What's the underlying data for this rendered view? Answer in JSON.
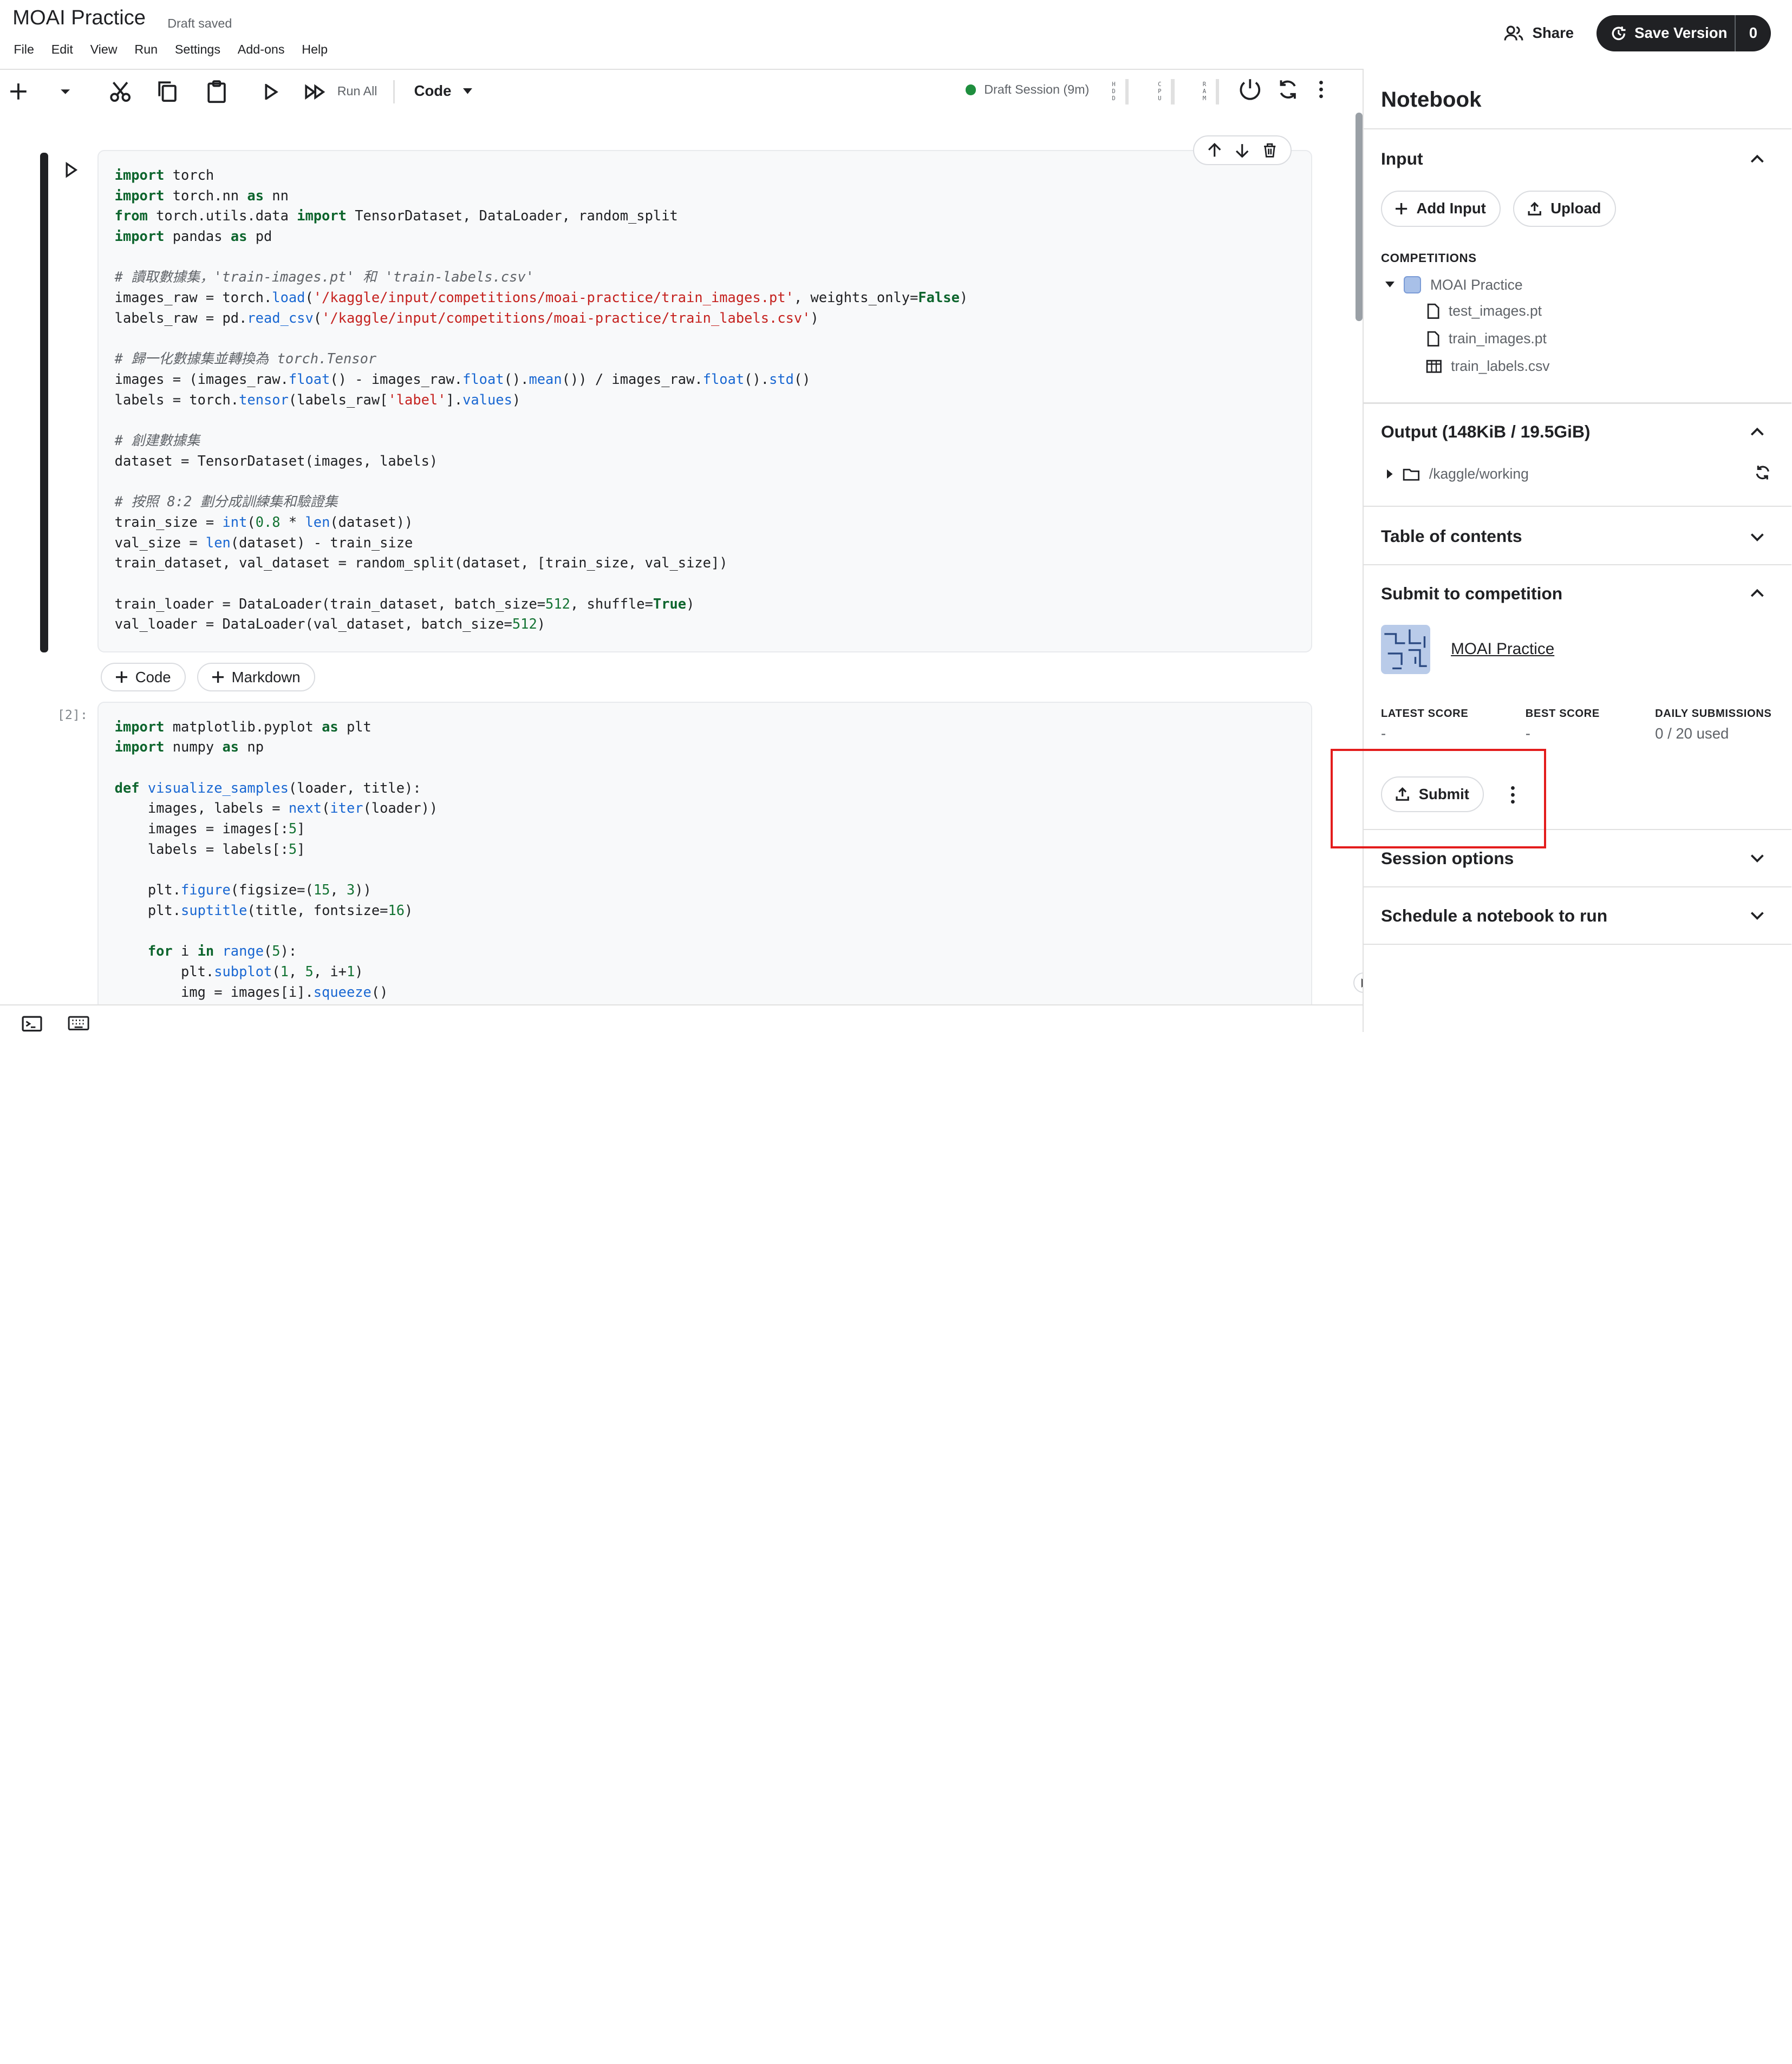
{
  "header": {
    "title": "MOAI Practice",
    "status": "Draft saved",
    "share_label": "Share",
    "save_version_label": "Save Version",
    "save_version_count": "0"
  },
  "menu": [
    "File",
    "Edit",
    "View",
    "Run",
    "Settings",
    "Add-ons",
    "Help"
  ],
  "toolbar": {
    "run_all_label": "Run All",
    "cell_type": "Code",
    "session_label": "Draft Session (9m)",
    "meters": [
      {
        "label": "HDD",
        "icon": "hdd-meter"
      },
      {
        "label": "CPU",
        "icon": "cpu-meter"
      },
      {
        "label": "RAM",
        "icon": "ram-meter"
      }
    ]
  },
  "cells": {
    "add_code_label": "Code",
    "add_markdown_label": "Markdown",
    "cell2_prompt": "[2]:"
  },
  "sidebar": {
    "title": "Notebook",
    "input": {
      "heading": "Input",
      "add_input_label": "Add Input",
      "upload_label": "Upload",
      "competitions_label": "COMPETITIONS",
      "competition_name": "MOAI Practice",
      "files": [
        "test_images.pt",
        "train_images.pt",
        "train_labels.csv"
      ]
    },
    "output": {
      "heading": "Output (148KiB / 19.5GiB)",
      "folder": "/kaggle/working"
    },
    "toc": {
      "heading": "Table of contents"
    },
    "submit": {
      "heading": "Submit to competition",
      "competition_link": "MOAI Practice",
      "latest_score_label": "LATEST SCORE",
      "latest_score_value": "-",
      "best_score_label": "BEST SCORE",
      "best_score_value": "-",
      "daily_submissions_label": "DAILY SUBMISSIONS",
      "daily_submissions_value": "0 / 20 used",
      "submit_label": "Submit"
    },
    "session_options": {
      "heading": "Session options"
    },
    "schedule": {
      "heading": "Schedule a notebook to run"
    }
  },
  "colors": {
    "accent_dark": "#202124",
    "session_dot": "#1e8e3e",
    "highlight_box": "#e31c1c",
    "keyword": "#0d652d",
    "string": "#c5221f"
  }
}
